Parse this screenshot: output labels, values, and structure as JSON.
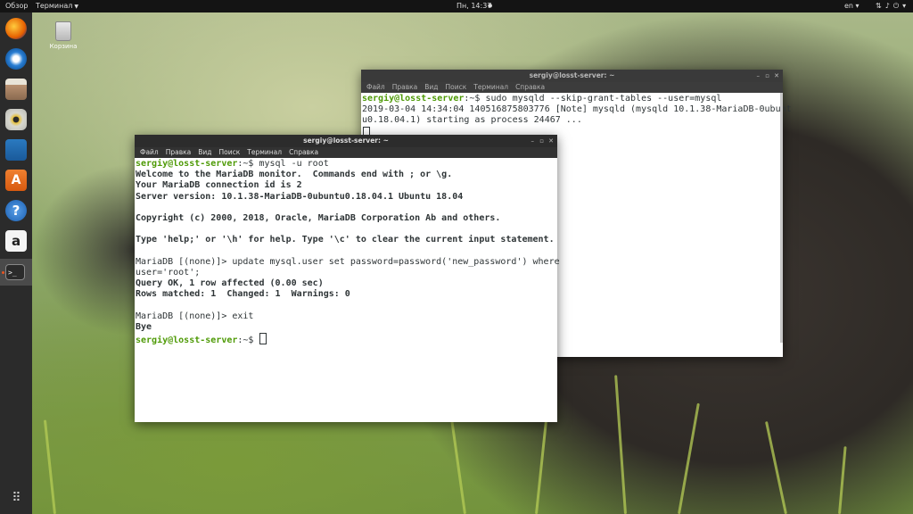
{
  "topbar": {
    "activities": "Обзор",
    "app_menu": "Терминал",
    "clock": "Пн, 14:37",
    "language": "en",
    "tray_icons": [
      "network-icon",
      "volume-icon",
      "power-icon"
    ]
  },
  "dock": {
    "apps": [
      "firefox-icon",
      "thunderbird-icon",
      "files-icon",
      "rhythmbox-icon",
      "writer-icon",
      "software-center-icon",
      "help-icon",
      "amazon-icon",
      "terminal-icon"
    ],
    "show_apps": "apps-grid-icon"
  },
  "desktop": {
    "trash_label": "Корзина"
  },
  "back_window": {
    "title": "sergiy@losst-server: ~",
    "menu": [
      "Файл",
      "Правка",
      "Вид",
      "Поиск",
      "Терминал",
      "Справка"
    ],
    "prompt": "sergiy@losst-server",
    "path": ":~$",
    "command": " sudo mysqld --skip-grant-tables --user=mysql",
    "out1": "2019-03-04 14:34:04 140516875803776 [Note] mysqld (mysqld 10.1.38-MariaDB-0ubunt",
    "out2": "u0.18.04.1) starting as process 24467 ..."
  },
  "front_window": {
    "title": "sergiy@losst-server: ~",
    "menu": [
      "Файл",
      "Правка",
      "Вид",
      "Поиск",
      "Терминал",
      "Справка"
    ],
    "prompt": "sergiy@losst-server",
    "path": ":~$",
    "cmd1": " mysql -u root",
    "l1": "Welcome to the MariaDB monitor.  Commands end with ; or \\g.",
    "l2": "Your MariaDB connection id is 2",
    "l3": "Server version: 10.1.38-MariaDB-0ubuntu0.18.04.1 Ubuntu 18.04",
    "l4": "Copyright (c) 2000, 2018, Oracle, MariaDB Corporation Ab and others.",
    "l5": "Type 'help;' or '\\h' for help. Type '\\c' to clear the current input statement.",
    "l6": "MariaDB [(none)]> update mysql.user set password=password('new_password') where",
    "l7": "user='root';",
    "l8": "Query OK, 1 row affected (0.00 sec)",
    "l9": "Rows matched: 1  Changed: 1  Warnings: 0",
    "l10": "MariaDB [(none)]> exit",
    "l11": "Bye"
  }
}
